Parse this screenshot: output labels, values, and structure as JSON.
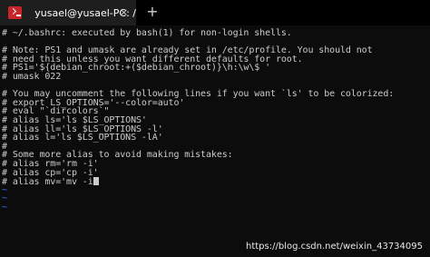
{
  "tab": {
    "title": "yusael@yusael-PC: /",
    "close_label": "×",
    "new_tab_label": "+"
  },
  "terminal": {
    "lines": [
      "# ~/.bashrc: executed by bash(1) for non-login shells.",
      "",
      "# Note: PS1 and umask are already set in /etc/profile. You should not",
      "# need this unless you want different defaults for root.",
      "# PS1='${debian_chroot:+($debian_chroot)}\\h:\\w\\$ '",
      "# umask 022",
      "",
      "# You may uncomment the following lines if you want `ls' to be colorized:",
      "# export LS_OPTIONS='--color=auto'",
      "# eval \"`dircolors`\"",
      "# alias ls='ls $LS_OPTIONS'",
      "# alias ll='ls $LS_OPTIONS -l'",
      "# alias l='ls $LS_OPTIONS -lA'",
      "#",
      "# Some more alias to avoid making mistakes:",
      "# alias rm='rm -i'",
      "# alias cp='cp -i'",
      "# alias mv='mv -i"
    ],
    "cursor_char": "'",
    "tildes": [
      "~",
      "~",
      "~"
    ]
  },
  "watermark": "https://blog.csdn.net/weixin_43734095",
  "colors": {
    "tab_active": "#1e1e1e",
    "terminal_bg": "#0c0c0c",
    "text": "#cccccc",
    "tilde": "#3b78ff",
    "icon": "#c8252b"
  }
}
